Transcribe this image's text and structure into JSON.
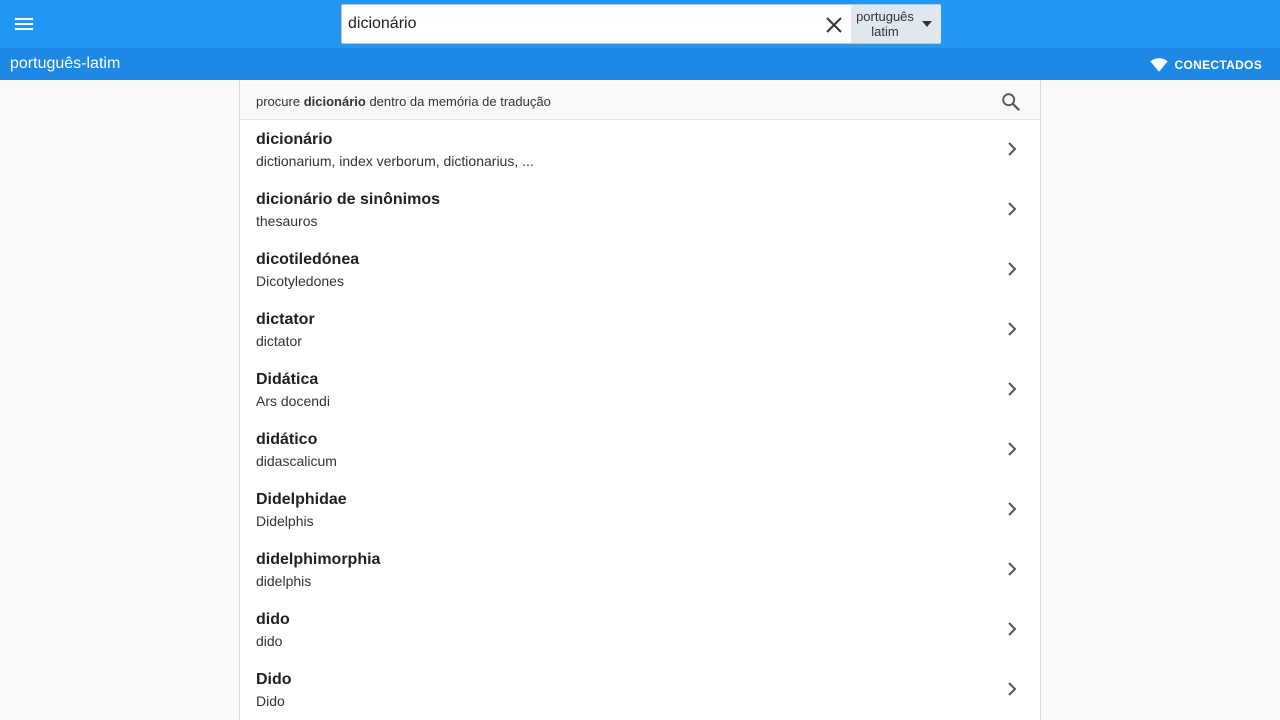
{
  "search": {
    "value": "dicionário",
    "lang_from": "português",
    "lang_to": "latim"
  },
  "header": {
    "title": "português-latim",
    "status_label": "CONECTADOS"
  },
  "tm": {
    "prefix": "procure ",
    "term": "dicionário",
    "suffix": " dentro da memória de tradução"
  },
  "results": [
    {
      "term": "dicionário",
      "translation": "dictionarium, index verborum, dictionarius, ..."
    },
    {
      "term": "dicionário de sinônimos",
      "translation": "thesauros"
    },
    {
      "term": "dicotiledónea",
      "translation": "Dicotyledones"
    },
    {
      "term": "dictator",
      "translation": "dictator"
    },
    {
      "term": "Didática",
      "translation": "Ars docendi"
    },
    {
      "term": "didático",
      "translation": "didascalicum"
    },
    {
      "term": "Didelphidae",
      "translation": "Didelphis"
    },
    {
      "term": "didelphimorphia",
      "translation": "didelphis"
    },
    {
      "term": "dido",
      "translation": "dido"
    },
    {
      "term": "Dido",
      "translation": "Dido"
    }
  ],
  "icons": {
    "menu": "menu-icon",
    "clear": "close-icon",
    "dropdown": "caret-down-icon",
    "connection": "wifi-icon",
    "search": "search-icon",
    "row_arrow": "chevron-right-icon"
  },
  "colors": {
    "topbar": "#2196f3",
    "subbar": "#1e88e5",
    "lang_select_bg": "#dfe8ee"
  }
}
